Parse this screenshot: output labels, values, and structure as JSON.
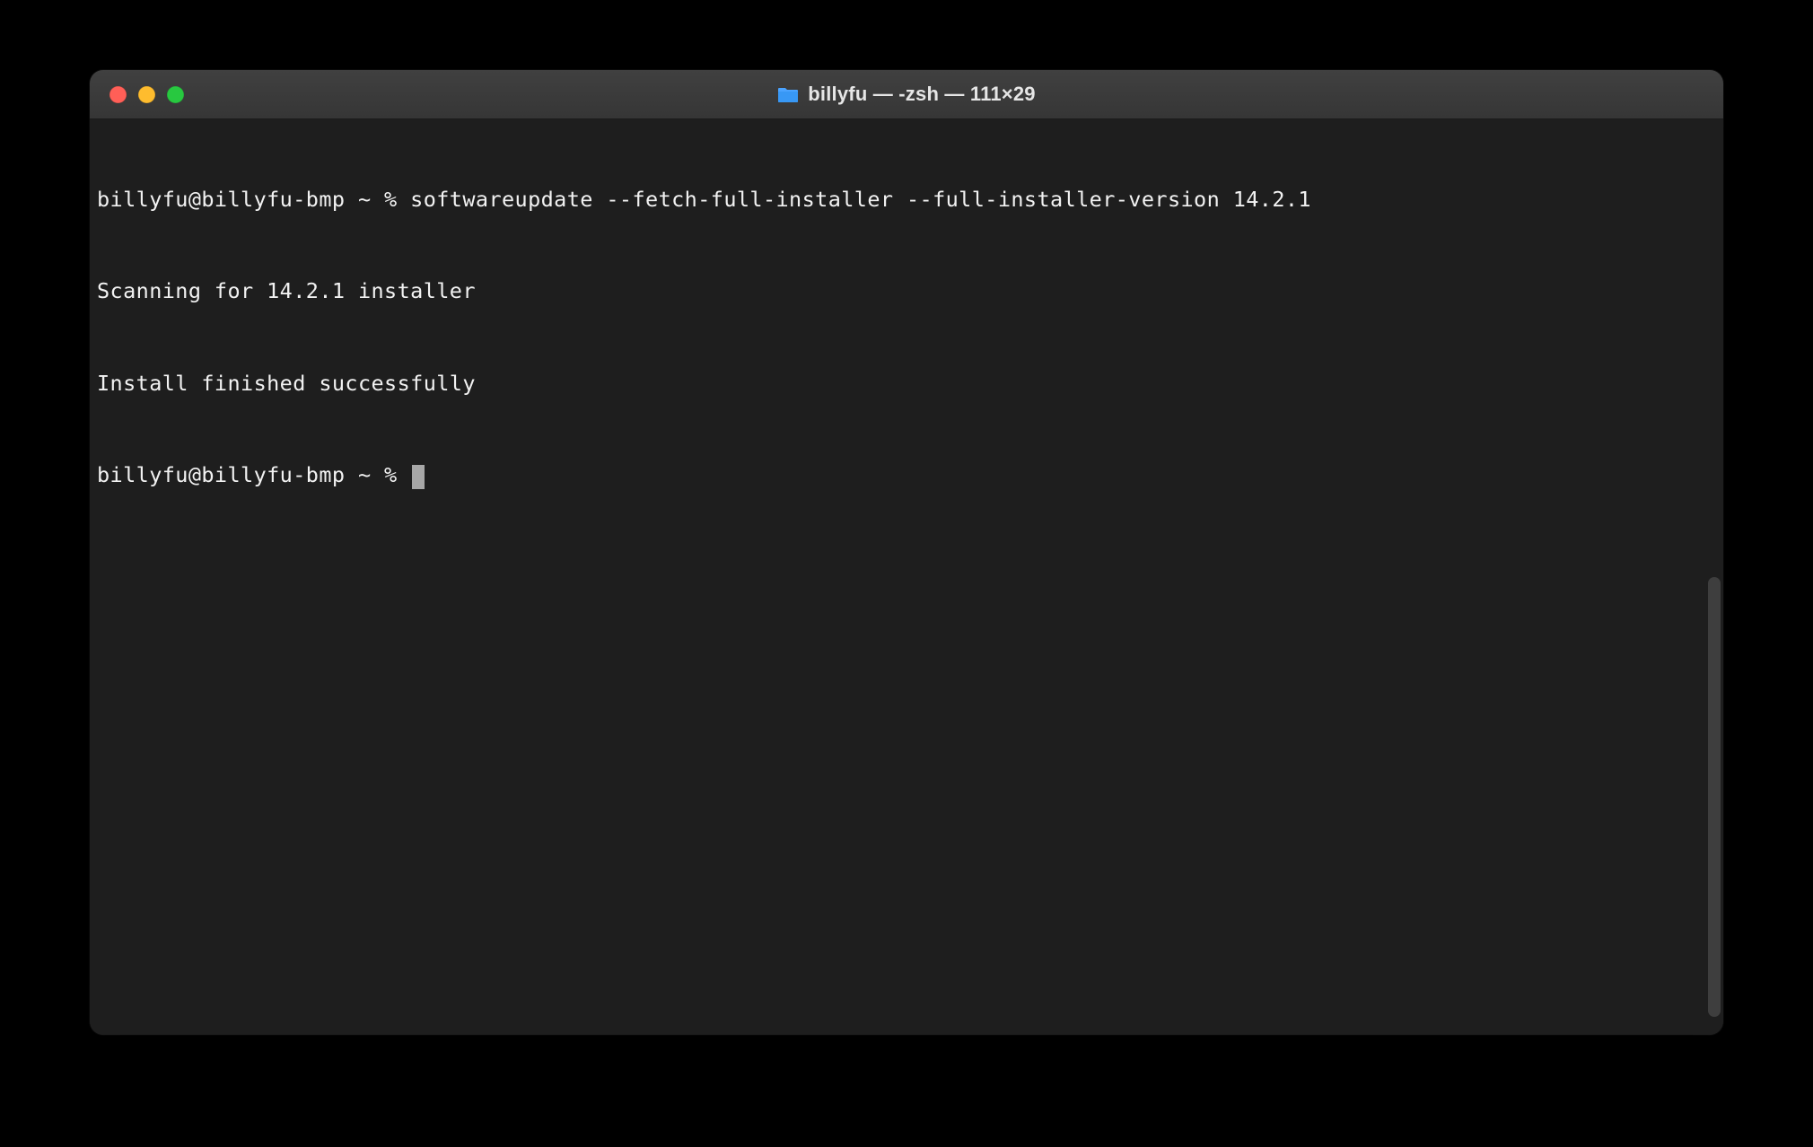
{
  "window": {
    "title": "billyfu — -zsh — 111×29"
  },
  "terminal": {
    "lines": [
      "billyfu@billyfu-bmp ~ % softwareupdate --fetch-full-installer --full-installer-version 14.2.1",
      "Scanning for 14.2.1 installer",
      "Install finished successfully"
    ],
    "prompt_idle": "billyfu@billyfu-bmp ~ % "
  }
}
